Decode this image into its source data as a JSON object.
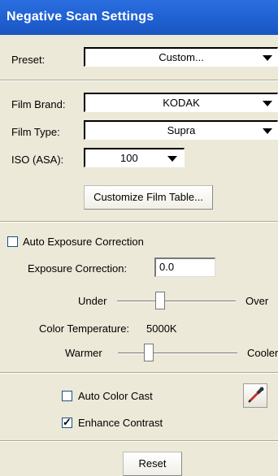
{
  "window": {
    "title": "Negative Scan Settings"
  },
  "preset": {
    "label": "Preset:",
    "value": "Custom..."
  },
  "film": {
    "brand_label": "Film Brand:",
    "brand_value": "KODAK",
    "type_label": "Film Type:",
    "type_value": "Supra",
    "iso_label": "ISO (ASA):",
    "iso_value": "100",
    "customize_button": "Customize Film Table..."
  },
  "exposure": {
    "auto_label": "Auto Exposure Correction",
    "auto_checked": false,
    "correction_label": "Exposure Correction:",
    "correction_value": "0.0",
    "under_label": "Under",
    "over_label": "Over",
    "exposure_slider_level": 0.33,
    "color_temp_label": "Color Temperature:",
    "color_temp_value": "5000K",
    "warmer_label": "Warmer",
    "cooler_label": "Cooler",
    "temp_slider_level": 0.27
  },
  "color": {
    "auto_cast_label": "Auto Color Cast",
    "auto_cast_checked": false,
    "enhance_contrast_label": "Enhance Contrast",
    "enhance_contrast_checked": true,
    "picker_icon": "eyedropper-icon"
  },
  "actions": {
    "reset_button": "Reset"
  },
  "colors": {
    "titlebar": "#1f5fd0",
    "panel": "#ece9d8"
  }
}
